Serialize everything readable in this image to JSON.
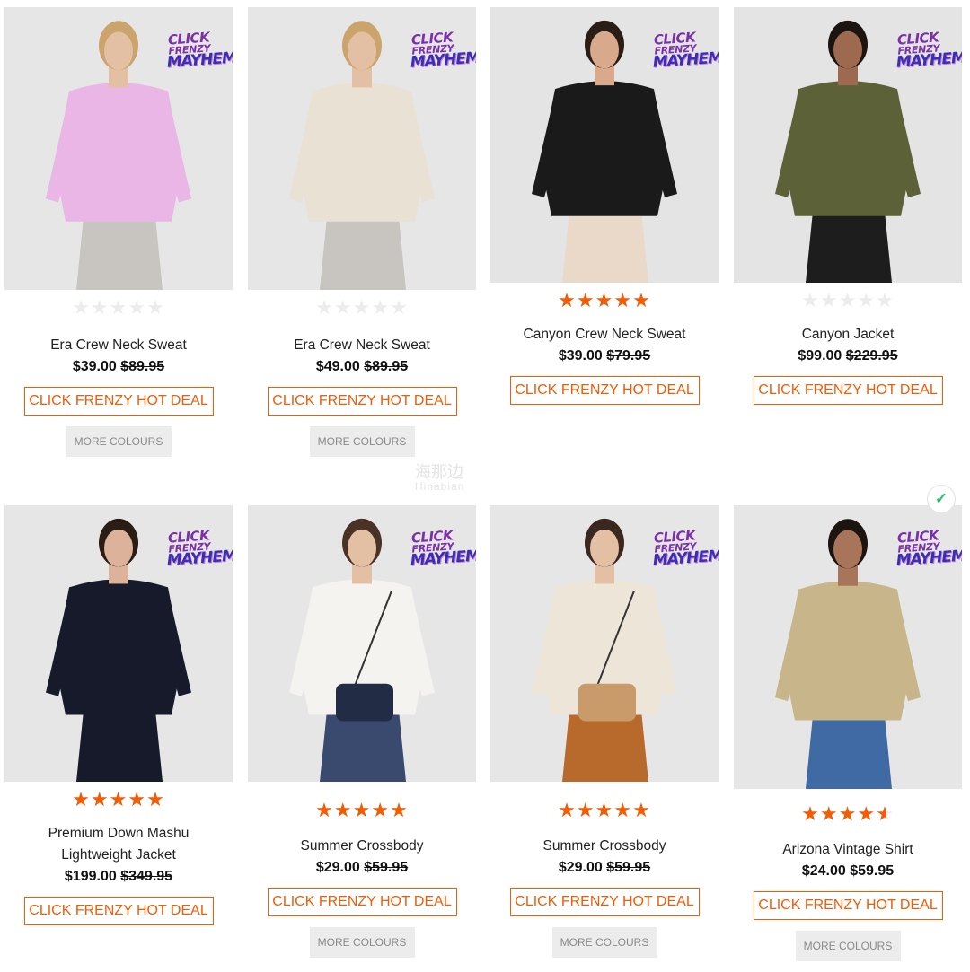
{
  "products": [
    {
      "name": "Era Crew Neck Sweat",
      "price": "$39.00",
      "was": "$89.95",
      "rating": 0,
      "badge": true,
      "deal_label": "CLICK FRENZY HOT DEAL",
      "more_colours": "MORE COLOURS",
      "colors": {
        "top": "#e9b6e6",
        "bottom": "#c8c4bf",
        "skin": "#e3bfa3",
        "hair": "#caa46c",
        "bg": "#e6e6e6"
      }
    },
    {
      "name": "Era Crew Neck Sweat",
      "price": "$49.00",
      "was": "$89.95",
      "rating": 0,
      "badge": true,
      "deal_label": "CLICK FRENZY HOT DEAL",
      "more_colours": "MORE COLOURS",
      "colors": {
        "top": "#e9e1d3",
        "bottom": "#c8c4bf",
        "skin": "#e3bfa3",
        "hair": "#caa46c",
        "bg": "#e6e6e6"
      }
    },
    {
      "name": "Canyon Crew Neck Sweat",
      "price": "$39.00",
      "was": "$79.95",
      "rating": 5,
      "badge": true,
      "deal_label": "CLICK FRENZY HOT DEAL",
      "more_colours": "",
      "colors": {
        "top": "#1a1a1a",
        "bottom": "#ead8c8",
        "skin": "#d9a98c",
        "hair": "#2a1d16",
        "bg": "#e4e4e4"
      }
    },
    {
      "name": "Canyon Jacket",
      "price": "$99.00",
      "was": "$229.95",
      "rating": 0,
      "badge": true,
      "deal_label": "CLICK FRENZY HOT DEAL",
      "more_colours": "",
      "colors": {
        "top": "#5c6137",
        "bottom": "#1d1d1d",
        "skin": "#9e6a4f",
        "hair": "#1c1410",
        "bg": "#e4e4e4"
      }
    },
    {
      "name": "Premium Down Mashu Lightweight Jacket",
      "price": "$199.00",
      "was": "$349.95",
      "rating": 5,
      "badge": true,
      "deal_label": "CLICK FRENZY HOT DEAL",
      "more_colours": "",
      "colors": {
        "top": "#161a2b",
        "bottom": "#161a2b",
        "skin": "#dcb39a",
        "hair": "#2a1d16",
        "bg": "#e6e6e6"
      }
    },
    {
      "name": "Summer Crossbody",
      "price": "$29.00",
      "was": "$59.95",
      "rating": 5,
      "badge": true,
      "deal_label": "CLICK FRENZY HOT DEAL",
      "more_colours": "MORE COLOURS",
      "colors": {
        "top": "#f4f3ef",
        "bottom": "#3a4a6e",
        "skin": "#e3bfa3",
        "hair": "#4a3226",
        "bg": "#e6e6e6",
        "bag": "#232c45"
      }
    },
    {
      "name": "Summer Crossbody",
      "price": "$29.00",
      "was": "$59.95",
      "rating": 5,
      "badge": true,
      "deal_label": "CLICK FRENZY HOT DEAL",
      "more_colours": "MORE COLOURS",
      "colors": {
        "top": "#ede6d8",
        "bottom": "#b86a2c",
        "skin": "#e3bfa3",
        "hair": "#3a2820",
        "bg": "#e6e6e6",
        "bag": "#c99a6a"
      }
    },
    {
      "name": "Arizona Vintage Shirt",
      "price": "$24.00",
      "was": "$59.95",
      "rating": 4.5,
      "badge": true,
      "deal_label": "CLICK FRENZY HOT DEAL",
      "more_colours": "MORE COLOURS",
      "colors": {
        "top": "#c9b58a",
        "bottom": "#3f6aa3",
        "skin": "#a8745a",
        "hair": "#1c1410",
        "bg": "#e6e6e6"
      }
    }
  ],
  "badge_text": {
    "line1": "CLICK",
    "line2": "FRENZY",
    "line3": "MAYHEM"
  },
  "watermark": {
    "line1": "海那边",
    "line2": "Hinabian"
  },
  "corner_icon": "check-logo-icon"
}
